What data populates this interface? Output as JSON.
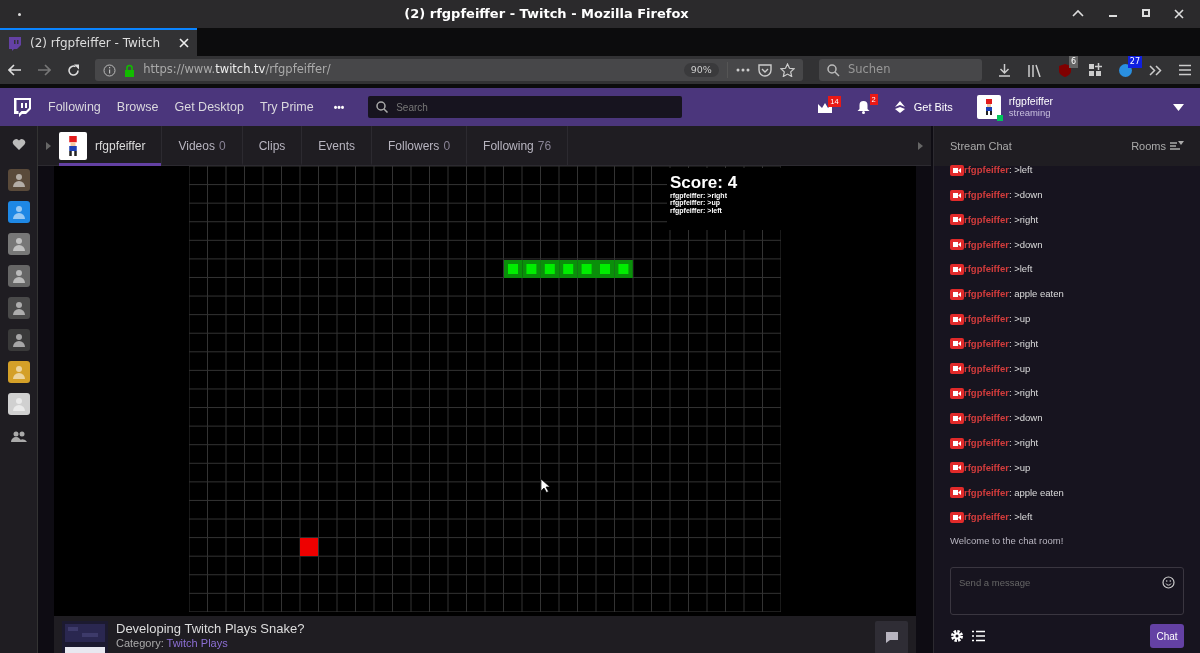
{
  "window": {
    "title": "(2) rfgpfeiffer - Twitch - Mozilla Firefox"
  },
  "browser": {
    "tab": {
      "title": "(2) rfgpfeiffer - Twitch"
    },
    "url": {
      "host": "https://www.",
      "domain": "twitch.tv",
      "path": "/rfgpfeiffer/"
    },
    "zoom": "90%",
    "search": {
      "placeholder": "Suchen"
    },
    "ublock_count": "6",
    "ext_count": "27"
  },
  "nav": {
    "links": [
      {
        "label": "Following"
      },
      {
        "label": "Browse"
      },
      {
        "label": "Get Desktop"
      },
      {
        "label": "Try Prime"
      }
    ],
    "more": "•••",
    "search": {
      "placeholder": "Search"
    },
    "prime_count": "14",
    "notif_count": "2",
    "get_bits": "Get Bits",
    "user": {
      "name": "rfgpfeiffer",
      "status": "streaming"
    }
  },
  "sidebar": {
    "channels": [
      {
        "color": "#5a4a3a"
      },
      {
        "color": "#1e88e5"
      },
      {
        "color": "#777777"
      },
      {
        "color": "#666666"
      },
      {
        "color": "#4a4a4a"
      },
      {
        "color": "#3a3a3a"
      },
      {
        "color": "#d4a028"
      },
      {
        "color": "#d0d0d0"
      }
    ]
  },
  "channel_bar": {
    "tabs": [
      {
        "kind": "profile",
        "label": "rfgpfeiffer",
        "selected": true
      },
      {
        "kind": "text",
        "label": "Videos",
        "count": "0",
        "selected": false
      },
      {
        "kind": "text",
        "label": "Clips",
        "selected": false
      },
      {
        "kind": "text",
        "label": "Events",
        "selected": false
      },
      {
        "kind": "text",
        "label": "Followers",
        "count": "0",
        "selected": false
      },
      {
        "kind": "text",
        "label": "Following",
        "count": "76",
        "selected": false
      }
    ]
  },
  "stream": {
    "score": "Score: 4",
    "log": [
      "rfgpfeiffer: >right",
      "rfgpfeiffer: >up",
      "rfgpfeiffer: >left"
    ]
  },
  "info": {
    "title": "Developing Twitch Plays Snake?",
    "category_label": "Category:",
    "category": "Twitch Plays"
  },
  "chat": {
    "title": "Stream Chat",
    "rooms": "Rooms",
    "messages": [
      {
        "user": "rfgpfeiffer",
        "text": ": >left"
      },
      {
        "user": "rfgpfeiffer",
        "text": ": >down"
      },
      {
        "user": "rfgpfeiffer",
        "text": ": >right"
      },
      {
        "user": "rfgpfeiffer",
        "text": ": >down"
      },
      {
        "user": "rfgpfeiffer",
        "text": ": >left"
      },
      {
        "user": "rfgpfeiffer",
        "text": ": apple eaten"
      },
      {
        "user": "rfgpfeiffer",
        "text": ": >up"
      },
      {
        "user": "rfgpfeiffer",
        "text": ": >right"
      },
      {
        "user": "rfgpfeiffer",
        "text": ": >up"
      },
      {
        "user": "rfgpfeiffer",
        "text": ": >right"
      },
      {
        "user": "rfgpfeiffer",
        "text": ": >down"
      },
      {
        "user": "rfgpfeiffer",
        "text": ": >right"
      },
      {
        "user": "rfgpfeiffer",
        "text": ": >up"
      },
      {
        "user": "rfgpfeiffer",
        "text": ": apple eaten"
      },
      {
        "user": "rfgpfeiffer",
        "text": ": >left"
      }
    ],
    "welcome": "Welcome to the chat room!",
    "input": {
      "placeholder": "Send a message"
    },
    "send": "Chat"
  }
}
